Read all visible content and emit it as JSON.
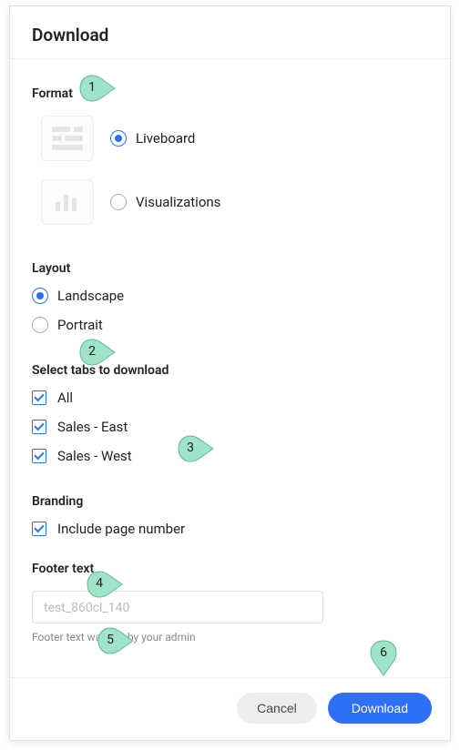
{
  "title": "Download",
  "sections": {
    "format": {
      "label": "Format",
      "options": {
        "liveboard": {
          "label": "Liveboard",
          "selected": true
        },
        "visualizations": {
          "label": "Visualizations",
          "selected": false
        }
      }
    },
    "layout": {
      "label": "Layout",
      "options": {
        "landscape": {
          "label": "Landscape",
          "selected": true
        },
        "portrait": {
          "label": "Portrait",
          "selected": false
        }
      }
    },
    "tabs": {
      "label": "Select tabs to download",
      "items": [
        {
          "label": "All",
          "checked": true
        },
        {
          "label": "Sales - East",
          "checked": true
        },
        {
          "label": "Sales - West",
          "checked": true
        }
      ]
    },
    "branding": {
      "label": "Branding",
      "include_page_number": {
        "label": "Include page number",
        "checked": true
      }
    },
    "footerText": {
      "label": "Footer text",
      "placeholder": "test_860cl_140",
      "hint": "Footer text was set by your admin"
    }
  },
  "buttons": {
    "cancel": "Cancel",
    "download": "Download"
  },
  "callouts": {
    "1": "1",
    "2": "2",
    "3": "3",
    "4": "4",
    "5": "5",
    "6": "6"
  }
}
